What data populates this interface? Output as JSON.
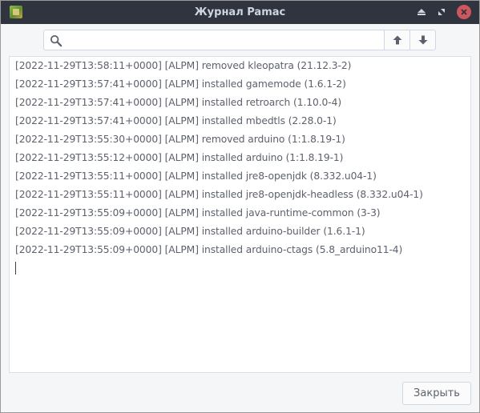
{
  "window": {
    "title": "Журнал Pamac",
    "icon": "pamac-app-icon"
  },
  "titlebar_buttons": {
    "minimize_icon": "minimize-icon",
    "maximize_icon": "maximize-icon",
    "close_icon": "close-icon"
  },
  "search": {
    "placeholder": "",
    "value": "",
    "icon": "search-icon"
  },
  "navigation": {
    "up_icon": "arrow-up-icon",
    "down_icon": "arrow-down-icon"
  },
  "log": {
    "lines": [
      "[2022-11-29T13:58:11+0000] [ALPM] removed kleopatra (21.12.3-2)",
      "[2022-11-29T13:57:41+0000] [ALPM] installed gamemode (1.6.1-2)",
      "[2022-11-29T13:57:41+0000] [ALPM] installed retroarch (1.10.0-4)",
      "[2022-11-29T13:57:41+0000] [ALPM] installed mbedtls (2.28.0-1)",
      "[2022-11-29T13:55:30+0000] [ALPM] removed arduino (1:1.8.19-1)",
      "[2022-11-29T13:55:12+0000] [ALPM] installed arduino (1:1.8.19-1)",
      "[2022-11-29T13:55:11+0000] [ALPM] installed jre8-openjdk (8.332.u04-1)",
      "[2022-11-29T13:55:11+0000] [ALPM] installed jre8-openjdk-headless (8.332.u04-1)",
      "[2022-11-29T13:55:09+0000] [ALPM] installed java-runtime-common (3-3)",
      "[2022-11-29T13:55:09+0000] [ALPM] installed arduino-builder (1.6.1-1)",
      "[2022-11-29T13:55:09+0000] [ALPM] installed arduino-ctags (5.8_arduino11-4)"
    ]
  },
  "footer": {
    "close_label": "Закрыть"
  }
}
